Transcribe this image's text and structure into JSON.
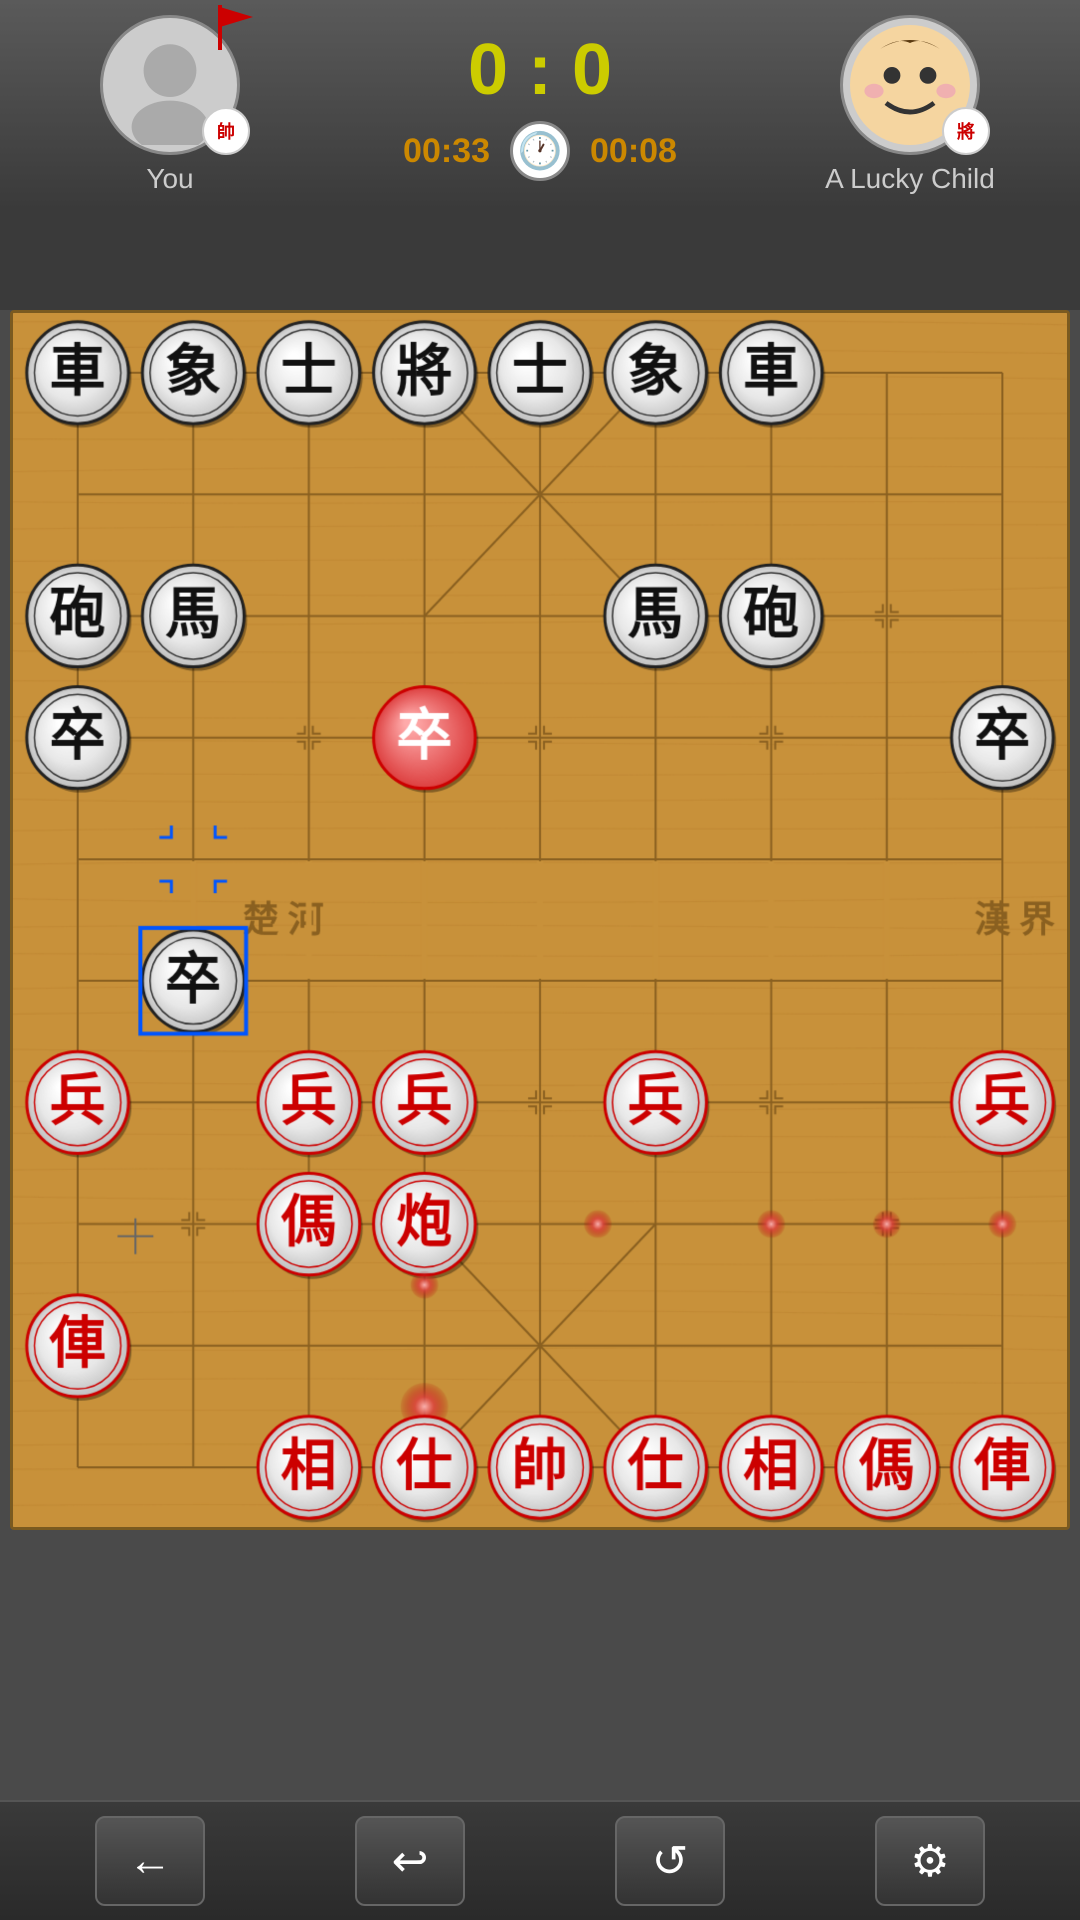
{
  "header": {
    "player1": {
      "name": "You",
      "badge": "帥",
      "score": "0"
    },
    "player2": {
      "name": "A Lucky Child",
      "badge": "將",
      "score": "0"
    },
    "colon": ":",
    "timer1": "00:33",
    "timer2": "00:08"
  },
  "toolbar": {
    "back_label": "←",
    "undo_label": "↩",
    "refresh_label": "↺",
    "settings_label": "⚙"
  },
  "board": {
    "black_pieces": [
      {
        "char": "車",
        "col": 0,
        "row": 0
      },
      {
        "char": "象",
        "col": 1,
        "row": 0
      },
      {
        "char": "士",
        "col": 2,
        "row": 0
      },
      {
        "char": "將",
        "col": 3,
        "row": 0
      },
      {
        "char": "士",
        "col": 4,
        "row": 0
      },
      {
        "char": "象",
        "col": 5,
        "row": 0
      },
      {
        "char": "車",
        "col": 6,
        "row": 0
      },
      {
        "char": "砲",
        "col": 0,
        "row": 2
      },
      {
        "char": "馬",
        "col": 1,
        "row": 2
      },
      {
        "char": "馬",
        "col": 5,
        "row": 2
      },
      {
        "char": "砲",
        "col": 6,
        "row": 2
      },
      {
        "char": "卒",
        "col": 0,
        "row": 4
      },
      {
        "char": "卒",
        "col": 3,
        "row": 4
      },
      {
        "char": "卒",
        "col": 6,
        "row": 4
      },
      {
        "char": "卒",
        "col": 1,
        "row": 5
      }
    ],
    "red_pieces": [
      {
        "char": "兵",
        "col": 0,
        "row": 6
      },
      {
        "char": "兵",
        "col": 2,
        "row": 6
      },
      {
        "char": "兵",
        "col": 3,
        "row": 6
      },
      {
        "char": "兵",
        "col": 5,
        "row": 6
      },
      {
        "char": "兵",
        "col": 6,
        "row": 6
      },
      {
        "char": "傌",
        "col": 2,
        "row": 7
      },
      {
        "char": "炮",
        "col": 3,
        "row": 7
      },
      {
        "char": "俥",
        "col": 0,
        "row": 8
      },
      {
        "char": "相",
        "col": 2,
        "row": 9
      },
      {
        "char": "仕",
        "col": 3,
        "row": 9
      },
      {
        "char": "帥",
        "col": 3,
        "row": 9
      },
      {
        "char": "仕",
        "col": 4,
        "row": 9
      },
      {
        "char": "相",
        "col": 5,
        "row": 9
      },
      {
        "char": "傌",
        "col": 6,
        "row": 9
      },
      {
        "char": "俥",
        "col": 7,
        "row": 9
      }
    ]
  }
}
